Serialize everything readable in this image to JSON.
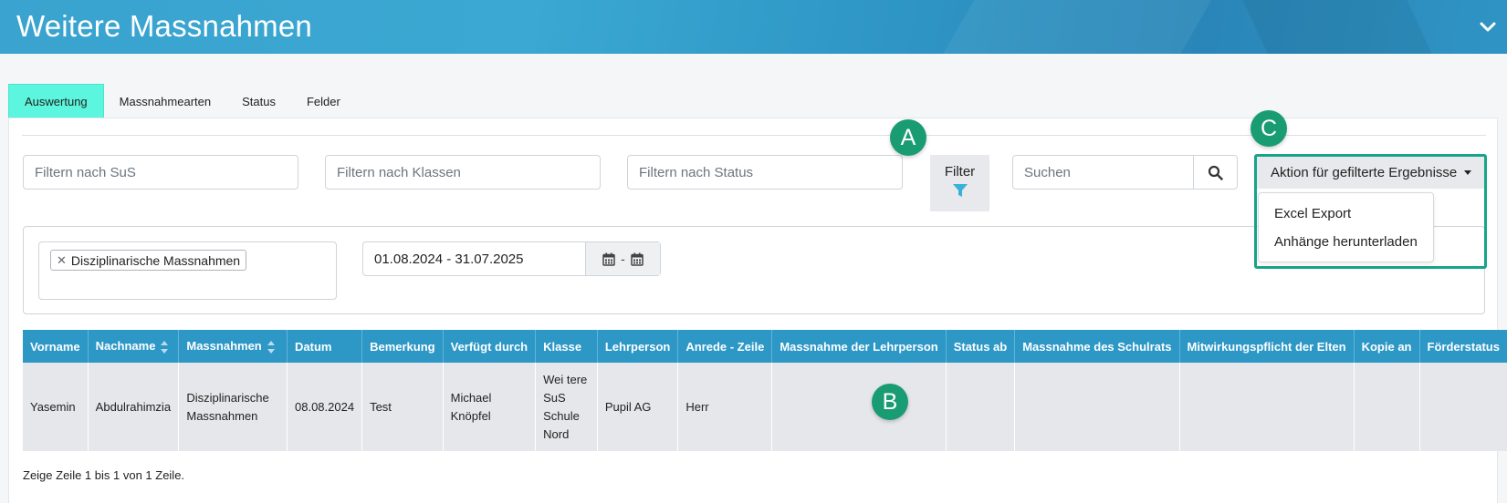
{
  "header": {
    "title": "Weitere Massnahmen"
  },
  "tabs": [
    {
      "label": "Auswertung",
      "active": true
    },
    {
      "label": "Massnahmearten",
      "active": false
    },
    {
      "label": "Status",
      "active": false
    },
    {
      "label": "Felder",
      "active": false
    }
  ],
  "filters": {
    "sus_placeholder": "Filtern nach SuS",
    "klassen_placeholder": "Filtern nach Klassen",
    "status_placeholder": "Filtern nach Status",
    "filter_button": "Filter",
    "search_placeholder": "Suchen"
  },
  "action": {
    "label": "Aktion für gefilterte Ergebnisse",
    "items": [
      "Excel Export",
      "Anhänge herunterladen"
    ]
  },
  "selection": {
    "tag": "Disziplinarische Massnahmen",
    "date_range": "01.08.2024 - 31.07.2025",
    "date_separator": "-"
  },
  "table": {
    "columns": [
      "Vorname",
      "Nachname",
      "Massnahmen",
      "Datum",
      "Bemerkung",
      "Verfügt durch",
      "Klasse",
      "Lehrperson",
      "Anrede - Zeile",
      "Massnahme der Lehrperson",
      "Status ab",
      "Massnahme des Schulrats",
      "Mitwirkungspflicht der Elten",
      "Kopie an",
      "Förderstatus"
    ],
    "rows": [
      [
        "Yasemin",
        "Abdulrahimzia",
        "Disziplinarische Massnahmen",
        "08.08.2024",
        "Test",
        "Michael Knöpfel",
        "Wei tere SuS Schule Nord",
        "Pupil AG",
        "Herr",
        "",
        "",
        "",
        "",
        "",
        ""
      ]
    ]
  },
  "footer": {
    "summary": "Zeige Zeile 1 bis 1 von 1 Zeile."
  },
  "annotations": [
    "A",
    "B",
    "C"
  ],
  "colors": {
    "header": "#2e95c4",
    "active_tab": "#5cf5dd",
    "table_header": "#2d97c6",
    "badge": "#1a9c73",
    "highlight_border": "#17a589"
  }
}
